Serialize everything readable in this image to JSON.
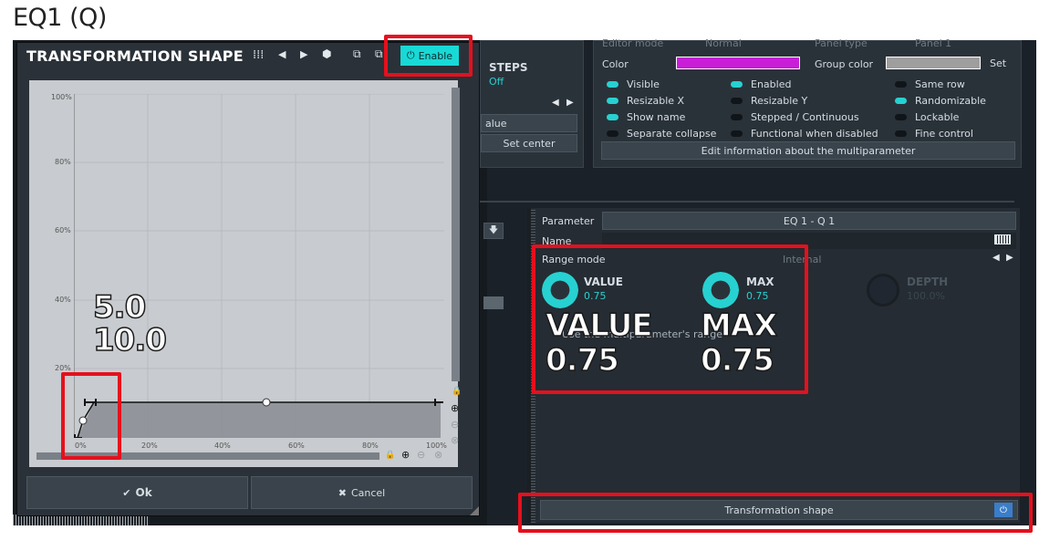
{
  "page_title": "EQ1 (Q)",
  "dialog": {
    "title": "TRANSFORMATION SHAPE",
    "enable_label": "Enable",
    "ok_label": "Ok",
    "cancel_label": "Cancel",
    "y_ticks": [
      "100%",
      "80%",
      "60%",
      "40%",
      "20%"
    ],
    "x_ticks": [
      "0%",
      "20%",
      "40%",
      "60%",
      "80%",
      "100%"
    ],
    "overlay_value_1": "5.0",
    "overlay_value_2": "10.0"
  },
  "editor": {
    "steps_label": "STEPS",
    "steps_value": "Off",
    "value_button": "alue",
    "set_center_button": "Set center",
    "editor_mode_label": "Editor mode",
    "editor_mode_value": "Normal",
    "panel_type_label": "Panel type",
    "panel_type_value": "Panel 1",
    "color_label": "Color",
    "color_value": "#c81ed8",
    "group_color_label": "Group color",
    "group_color_value": "#9e9e9e",
    "set_label": "Set",
    "flags": [
      {
        "label": "Visible",
        "on": true
      },
      {
        "label": "Enabled",
        "on": true
      },
      {
        "label": "Same row",
        "on": false
      },
      {
        "label": "Resizable X",
        "on": true
      },
      {
        "label": "Resizable Y",
        "on": false
      },
      {
        "label": "Randomizable",
        "on": true
      },
      {
        "label": "Show name",
        "on": true
      },
      {
        "label": "Stepped / Continuous",
        "on": false
      },
      {
        "label": "Lockable",
        "on": false
      },
      {
        "label": "Separate collapse",
        "on": false
      },
      {
        "label": "Functional when disabled",
        "on": false
      },
      {
        "label": "Fine control",
        "on": false
      }
    ],
    "edit_info_button": "Edit information about the multiparameter"
  },
  "parameter": {
    "parameter_label": "Parameter",
    "parameter_value": "EQ 1 - Q 1",
    "name_label": "Name",
    "range_mode_label": "Range mode",
    "range_mode_value": "Internal",
    "knobs": [
      {
        "name": "VALUE",
        "value": "0.75"
      },
      {
        "name": "MAX",
        "value": "0.75"
      },
      {
        "name": "DEPTH",
        "value": "100.0%"
      }
    ],
    "range_text": "Use the multiparameter's range",
    "big_value_label": "VALUE",
    "big_value": "0.75",
    "big_max_label": "MAX",
    "big_max": "0.75",
    "transformation_shape_button": "Transformation shape"
  },
  "colors": {
    "accent": "#19d9d6",
    "highlight": "#e5101d"
  }
}
